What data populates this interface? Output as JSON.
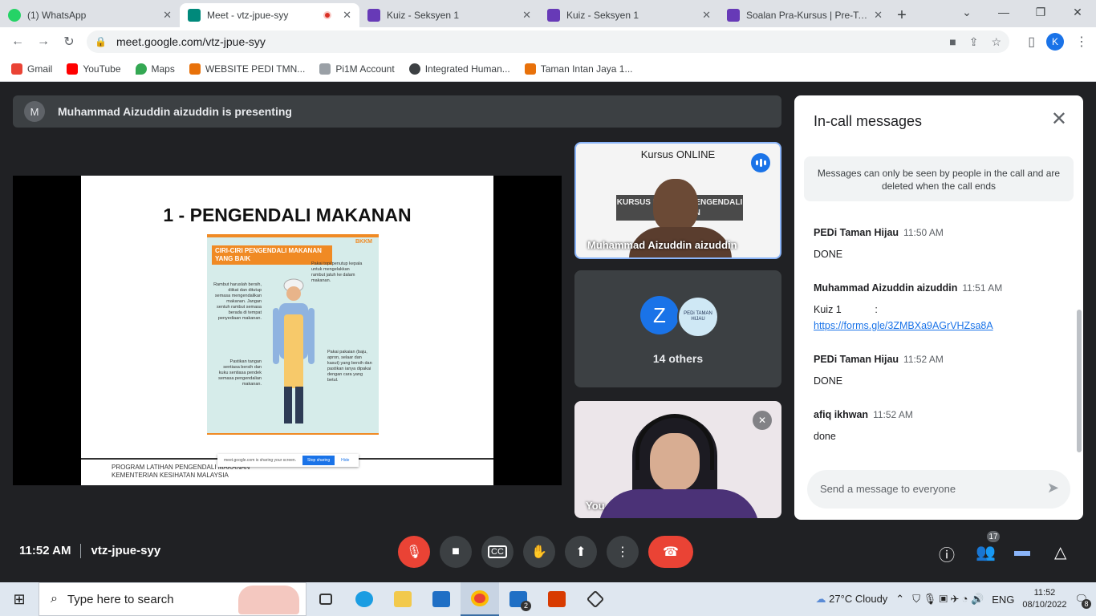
{
  "browser": {
    "tabs": [
      {
        "title": "(1) WhatsApp",
        "color": "#25d366"
      },
      {
        "title": "Meet - vtz-jpue-syy",
        "color": "#00897b",
        "recording": true
      },
      {
        "title": "Kuiz - Seksyen 1",
        "color": "#673ab7"
      },
      {
        "title": "Kuiz - Seksyen 1",
        "color": "#673ab7"
      },
      {
        "title": "Soalan Pra-Kursus | Pre-Test (",
        "color": "#673ab7"
      }
    ],
    "url": "meet.google.com/vtz-jpue-syy",
    "profile_initial": "K",
    "bookmarks": [
      {
        "label": "Gmail",
        "color": "#ea4335"
      },
      {
        "label": "YouTube",
        "color": "#ff0000"
      },
      {
        "label": "Maps",
        "color": "#34a853"
      },
      {
        "label": "WEBSITE PEDI TMN...",
        "color": "#e8710a"
      },
      {
        "label": "Pi1M Account",
        "color": "#9aa0a6"
      },
      {
        "label": "Integrated Human...",
        "color": "#3c4043"
      },
      {
        "label": "Taman Intan Jaya 1...",
        "color": "#e8710a"
      }
    ]
  },
  "meet": {
    "presenter_initial": "M",
    "presenting_text": "Muhammad Aizuddin aizuddin is presenting",
    "slide": {
      "title": "1 - PENGENDALI MAKANAN",
      "poster_title": "CIRI-CIRI PENGENDALI MAKANAN YANG BAIK",
      "poster_brand": "BKKM",
      "note_hat": "Pakai topi/penutup kepala untuk mengelakkan rambut jatuh ke dalam makanan.",
      "note_hair": "Rambut haruslah bersih, diikat dan ditutup semasa mengendalikan makanan. Jangan sentuh rambut semasa berada di tempat penyediaan makanan.",
      "note_hands": "Pastikan tangan sentiasa bersih dan kuku sentiasa pendek semasa pengendalian makanan.",
      "note_clothes": "Pakai pakaian (baju, apron, selaar dan kasut) yang bersih dan pastikan ianya dipakai dengan cara yang betul.",
      "footer_line1": "PROGRAM LATIHAN PENGENDALI MAKANAN",
      "footer_line2": "KEMENTERIAN KESIHATAN MALAYSIA",
      "share_text": "meet.google.com is sharing your screen.",
      "stop_sharing": "Stop sharing",
      "hide": "Hide"
    },
    "tiles": {
      "presenter_caption": "Kursus ONLINE",
      "board_text": "KURSUS LATIHAN PENGENDALI MAKANAN",
      "presenter_name": "Muhammad Aizuddin aizuddin",
      "others_initial": "Z",
      "others_avatar_text": "PEDi TAMAN HIJAU",
      "others_label": "14 others",
      "self_name": "You"
    },
    "panel": {
      "title": "In-call messages",
      "notice": "Messages can only be seen by people in the call and are deleted when the call ends",
      "messages": [
        {
          "sender": "PEDi Taman Hijau",
          "time": "11:50 AM",
          "text": "DONE"
        },
        {
          "sender": "Muhammad Aizuddin aizuddin",
          "time": "11:51 AM",
          "text": "Kuiz 1            :",
          "link": "https://forms.gle/3ZMBXa9AGrVHZsa8A"
        },
        {
          "sender": "PEDi Taman Hijau",
          "time": "11:52 AM",
          "text": "DONE"
        },
        {
          "sender": "afiq ikhwan",
          "time": "11:52 AM",
          "text": "done"
        }
      ],
      "input_placeholder": "Send a message to everyone"
    },
    "controls": {
      "time": "11:52 AM",
      "meeting_code": "vtz-jpue-syy",
      "participants_count": "17"
    }
  },
  "taskbar": {
    "search_placeholder": "Type here to search",
    "weather": "27°C  Cloudy",
    "language": "ENG",
    "time": "11:52",
    "date": "08/10/2022",
    "notification_count": "8",
    "mail_badge": "2"
  }
}
